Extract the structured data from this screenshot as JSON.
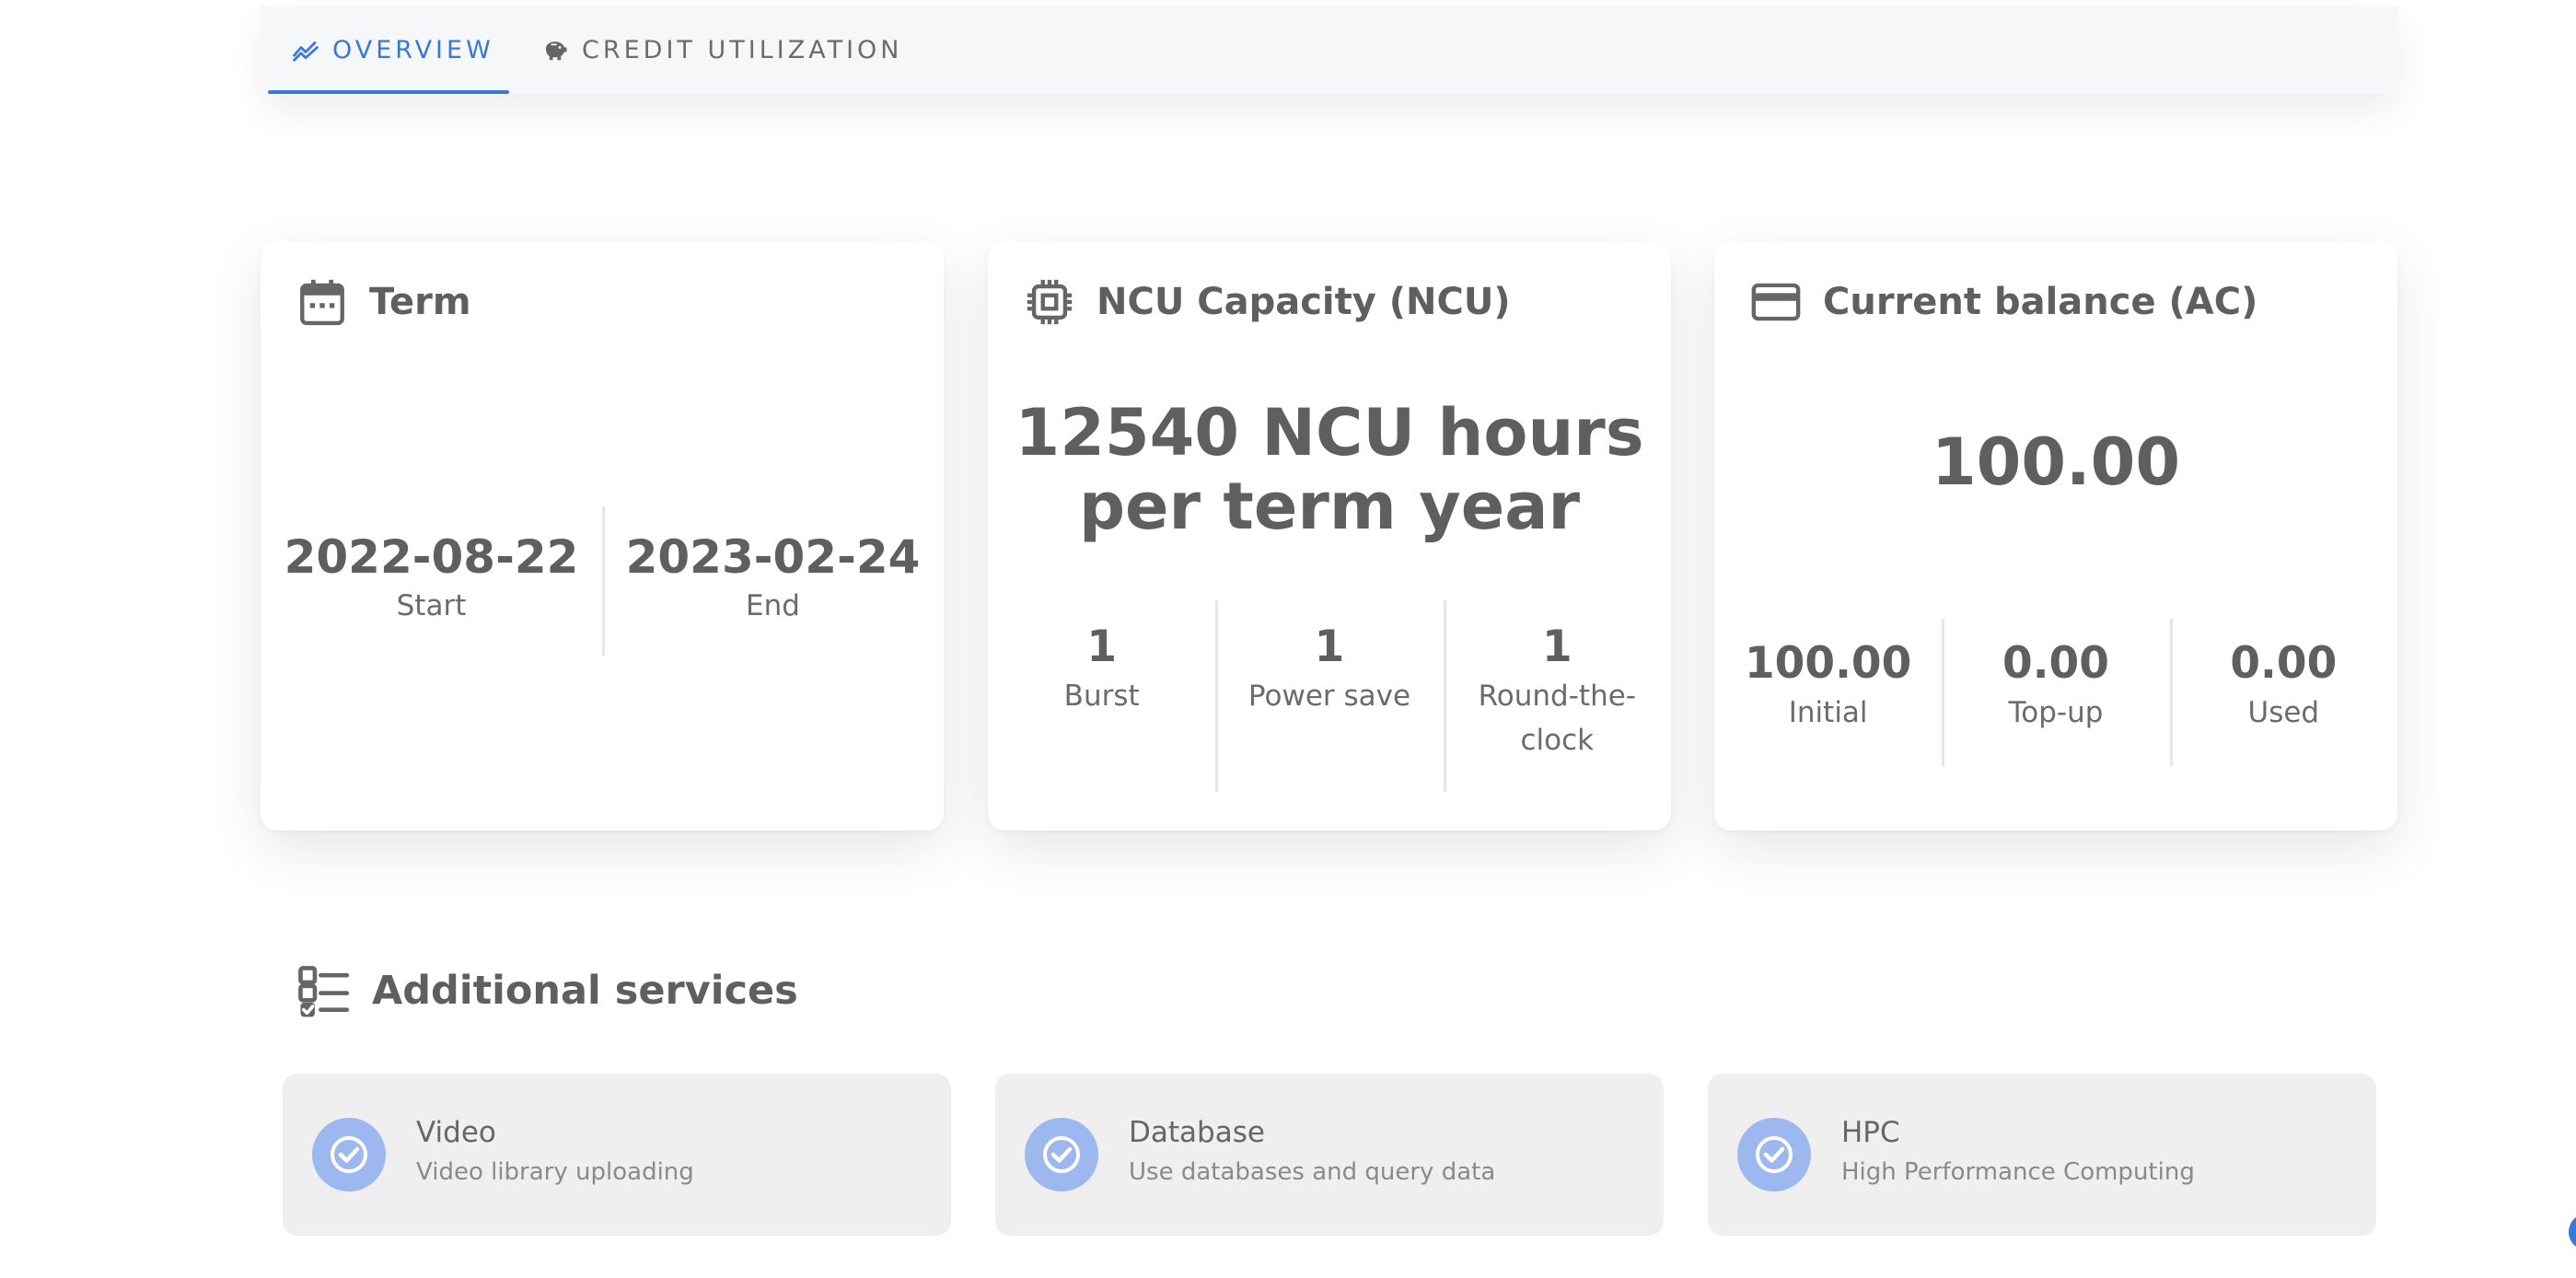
{
  "tabs": [
    {
      "label": "OVERVIEW",
      "icon": "trend-icon",
      "active": true
    },
    {
      "label": "CREDIT UTILIZATION",
      "icon": "piggy-bank-icon",
      "active": false
    }
  ],
  "term": {
    "title": "Term",
    "icon": "calendar-icon",
    "start_value": "2022-08-22",
    "start_label": "Start",
    "end_value": "2023-02-24",
    "end_label": "End"
  },
  "ncu": {
    "title": "NCU Capacity (NCU)",
    "icon": "chip-icon",
    "headline_line1": "12540 NCU hours",
    "headline_line2": "per term year",
    "stats": [
      {
        "value": "1",
        "label": "Burst"
      },
      {
        "value": "1",
        "label": "Power save"
      },
      {
        "value": "1",
        "label_line1": "Round-the-",
        "label_line2": "clock"
      }
    ]
  },
  "balance": {
    "title": "Current balance (AC)",
    "icon": "credit-card-icon",
    "headline": "100.00",
    "stats": [
      {
        "value": "100.00",
        "label": "Initial"
      },
      {
        "value": "0.00",
        "label": "Top-up"
      },
      {
        "value": "0.00",
        "label": "Used"
      }
    ]
  },
  "additional": {
    "title": "Additional services",
    "icon": "checklist-icon",
    "services": [
      {
        "name": "Video",
        "description": "Video library uploading"
      },
      {
        "name": "Database",
        "description": "Use databases and query data"
      },
      {
        "name": "HPC",
        "description": "High Performance Computing"
      }
    ]
  },
  "colors": {
    "accent": "#3a78d8",
    "text": "#5f5f5f",
    "service_bg": "#efefef",
    "check_bg": "#9db8ef"
  }
}
